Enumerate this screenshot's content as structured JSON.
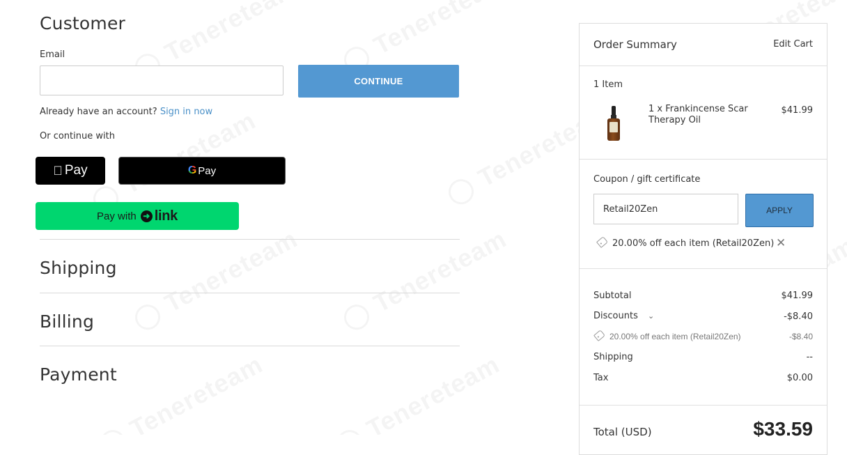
{
  "customer": {
    "heading": "Customer",
    "email_label": "Email",
    "email_value": "",
    "continue_label": "CONTINUE",
    "account_prompt": "Already have an account?",
    "sign_in_link": "Sign in now",
    "continue_with": "Or continue with",
    "apple_pay_label": "Pay",
    "google_pay_label": "Pay",
    "link_pay_with": "Pay with",
    "link_word": "link"
  },
  "sections": {
    "shipping": "Shipping",
    "billing": "Billing",
    "payment": "Payment"
  },
  "summary": {
    "title": "Order Summary",
    "edit_cart": "Edit Cart",
    "item_count": "1 Item",
    "item_name": "1 x Frankincense Scar Therapy Oil",
    "item_price": "$41.99",
    "coupon_link": "Coupon / gift certificate",
    "coupon_value": "Retail20Zen",
    "apply_label": "APPLY",
    "applied_coupon": "20.00% off each item (Retail20Zen)",
    "subtotal_label": "Subtotal",
    "subtotal_value": "$41.99",
    "discounts_label": "Discounts",
    "discounts_value": "-$8.40",
    "discount_detail_label": "20.00% off each item (Retail20Zen)",
    "discount_detail_value": "-$8.40",
    "shipping_label": "Shipping",
    "shipping_value": "--",
    "tax_label": "Tax",
    "tax_value": "$0.00",
    "total_label": "Total (USD)",
    "total_value": "$33.59"
  },
  "watermark": "Tenereteam",
  "colors": {
    "accent": "#5398d2",
    "link": "#4a90c8",
    "link_pay": "#00d66f"
  }
}
